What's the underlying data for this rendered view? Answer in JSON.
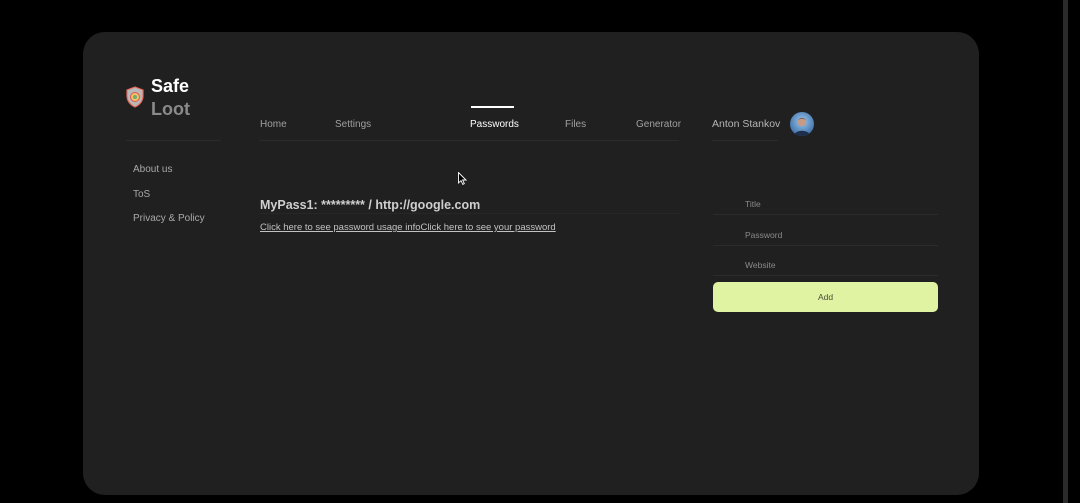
{
  "brand": {
    "name_line1": "Safe",
    "name_line2": "Loot"
  },
  "side_links": [
    "About us",
    "ToS",
    "Privacy & Policy"
  ],
  "nav": {
    "items": [
      "Home",
      "Settings",
      "Passwords",
      "Files",
      "Generator"
    ],
    "active": "Passwords"
  },
  "user": {
    "name": "Anton Stankov"
  },
  "passwords": [
    {
      "title": "MyPass1: ********* / http://google.com",
      "usage_link": "Click here to see password usage info",
      "reveal_link": "Click here to see your password"
    }
  ],
  "form": {
    "title_placeholder": "Title",
    "password_placeholder": "Password",
    "website_placeholder": "Website",
    "add_label": "Add"
  },
  "colors": {
    "background": "#000000",
    "panel": "#202020",
    "accent": "#dff3a2"
  }
}
